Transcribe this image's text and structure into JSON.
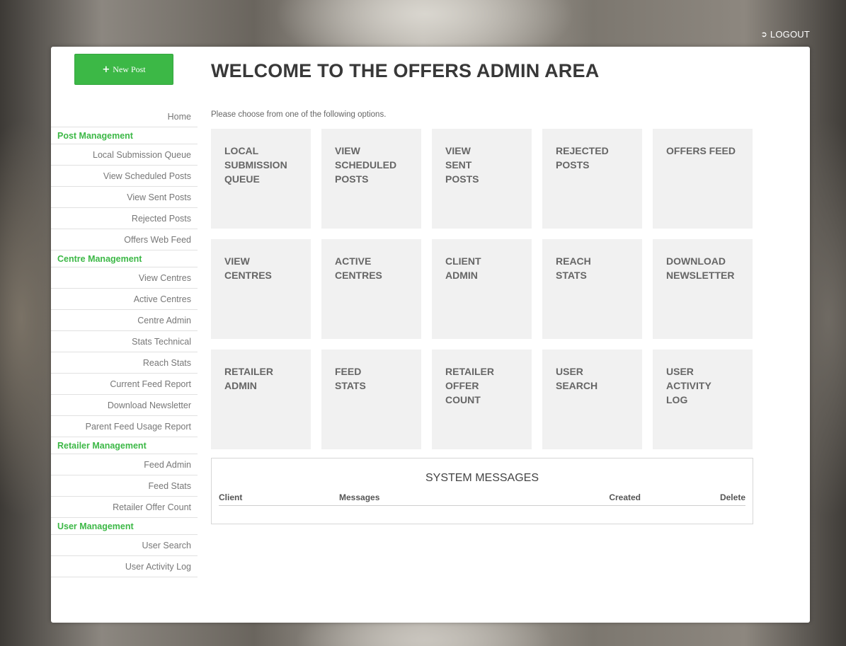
{
  "header": {
    "logout_label": "LOGOUT",
    "logout_icon": "sign-out-icon"
  },
  "sidebar": {
    "new_post_label": "New Post",
    "new_post_icon": "plus-icon",
    "home_label": "Home",
    "sections": [
      {
        "heading": "Post Management",
        "items": [
          "Local Submission Queue",
          "View Scheduled Posts",
          "View Sent Posts",
          "Rejected Posts",
          "Offers Web Feed"
        ]
      },
      {
        "heading": "Centre Management",
        "items": [
          "View Centres",
          "Active Centres",
          "Centre Admin",
          "Stats Technical",
          "Reach Stats",
          "Current Feed Report",
          "Download Newsletter",
          "Parent Feed Usage Report"
        ]
      },
      {
        "heading": "Retailer Management",
        "items": [
          "Feed Admin",
          "Feed Stats",
          "Retailer Offer Count"
        ]
      },
      {
        "heading": "User Management",
        "items": [
          "User Search",
          "User Activity Log"
        ]
      }
    ]
  },
  "main": {
    "title": "WELCOME TO THE OFFERS ADMIN AREA",
    "intro": "Please choose from one of the following options.",
    "tiles": [
      [
        "LOCAL",
        "SUBMISSION",
        "QUEUE"
      ],
      [
        "VIEW",
        "SCHEDULED",
        "POSTS"
      ],
      [
        "VIEW",
        "SENT",
        "POSTS"
      ],
      [
        "REJECTED",
        "POSTS"
      ],
      [
        "OFFERS FEED"
      ],
      [
        "VIEW",
        "CENTRES"
      ],
      [
        "ACTIVE",
        "CENTRES"
      ],
      [
        "CLIENT",
        "ADMIN"
      ],
      [
        "REACH",
        "STATS"
      ],
      [
        "DOWNLOAD",
        "NEWSLETTER"
      ],
      [
        "RETAILER",
        "ADMIN"
      ],
      [
        "FEED",
        "STATS"
      ],
      [
        "RETAILER",
        "OFFER",
        "COUNT"
      ],
      [
        "USER",
        "SEARCH"
      ],
      [
        "USER",
        "ACTIVITY",
        "LOG"
      ]
    ]
  },
  "system_messages": {
    "title": "SYSTEM MESSAGES",
    "columns": {
      "client": "Client",
      "messages": "Messages",
      "created": "Created",
      "delete": "Delete"
    }
  },
  "colors": {
    "accent": "#3cb846",
    "tile_bg": "#f1f1f1",
    "title_text": "#383838"
  }
}
